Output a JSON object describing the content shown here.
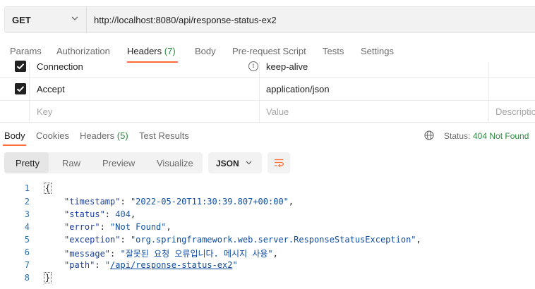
{
  "request": {
    "method": "GET",
    "url": "http://localhost:8080/api/response-status-ex2"
  },
  "request_tabs": [
    {
      "label": "Params"
    },
    {
      "label": "Authorization"
    },
    {
      "label": "Headers",
      "count": "(7)"
    },
    {
      "label": "Body"
    },
    {
      "label": "Pre-request Script"
    },
    {
      "label": "Tests"
    },
    {
      "label": "Settings"
    }
  ],
  "headers_table": {
    "rows": [
      {
        "key": "Connection",
        "value": "keep-alive",
        "checked": true
      },
      {
        "key": "Accept",
        "value": "application/json",
        "checked": true
      }
    ],
    "placeholder_key": "Key",
    "placeholder_value": "Value",
    "placeholder_description": "Descriptio"
  },
  "response_tabs": [
    {
      "label": "Body"
    },
    {
      "label": "Cookies"
    },
    {
      "label": "Headers",
      "count": "(5)"
    },
    {
      "label": "Test Results"
    }
  ],
  "status": {
    "label": "Status:",
    "value": "404 Not Found",
    "color": "#2a8a3d"
  },
  "view_modes": [
    "Pretty",
    "Raw",
    "Preview",
    "Visualize"
  ],
  "format": "JSON",
  "code": {
    "line_numbers": [
      "1",
      "2",
      "3",
      "4",
      "5",
      "6",
      "7",
      "8"
    ],
    "open_brace": "{",
    "close_brace": "}",
    "lines": [
      {
        "key": "\"timestamp\"",
        "value": "\"2022-05-20T11:30:39.807+00:00\"",
        "tail": ","
      },
      {
        "key": "\"status\"",
        "value": "404",
        "tail": ","
      },
      {
        "key": "\"error\"",
        "value": "\"Not Found\"",
        "tail": ","
      },
      {
        "key": "\"exception\"",
        "value": "\"org.springframework.web.server.ResponseStatusException\"",
        "tail": ","
      },
      {
        "key": "\"message\"",
        "value": "\"잘못된 요청 오류입니다. 메시지 사용\"",
        "tail": ","
      },
      {
        "key": "\"path\"",
        "value_prefix": "\"",
        "value_link": "/api/response-status-ex2",
        "value_suffix": "\"",
        "tail": ""
      }
    ]
  },
  "colors": {
    "accent": "#ff6c37",
    "success": "#2a8a3d"
  }
}
